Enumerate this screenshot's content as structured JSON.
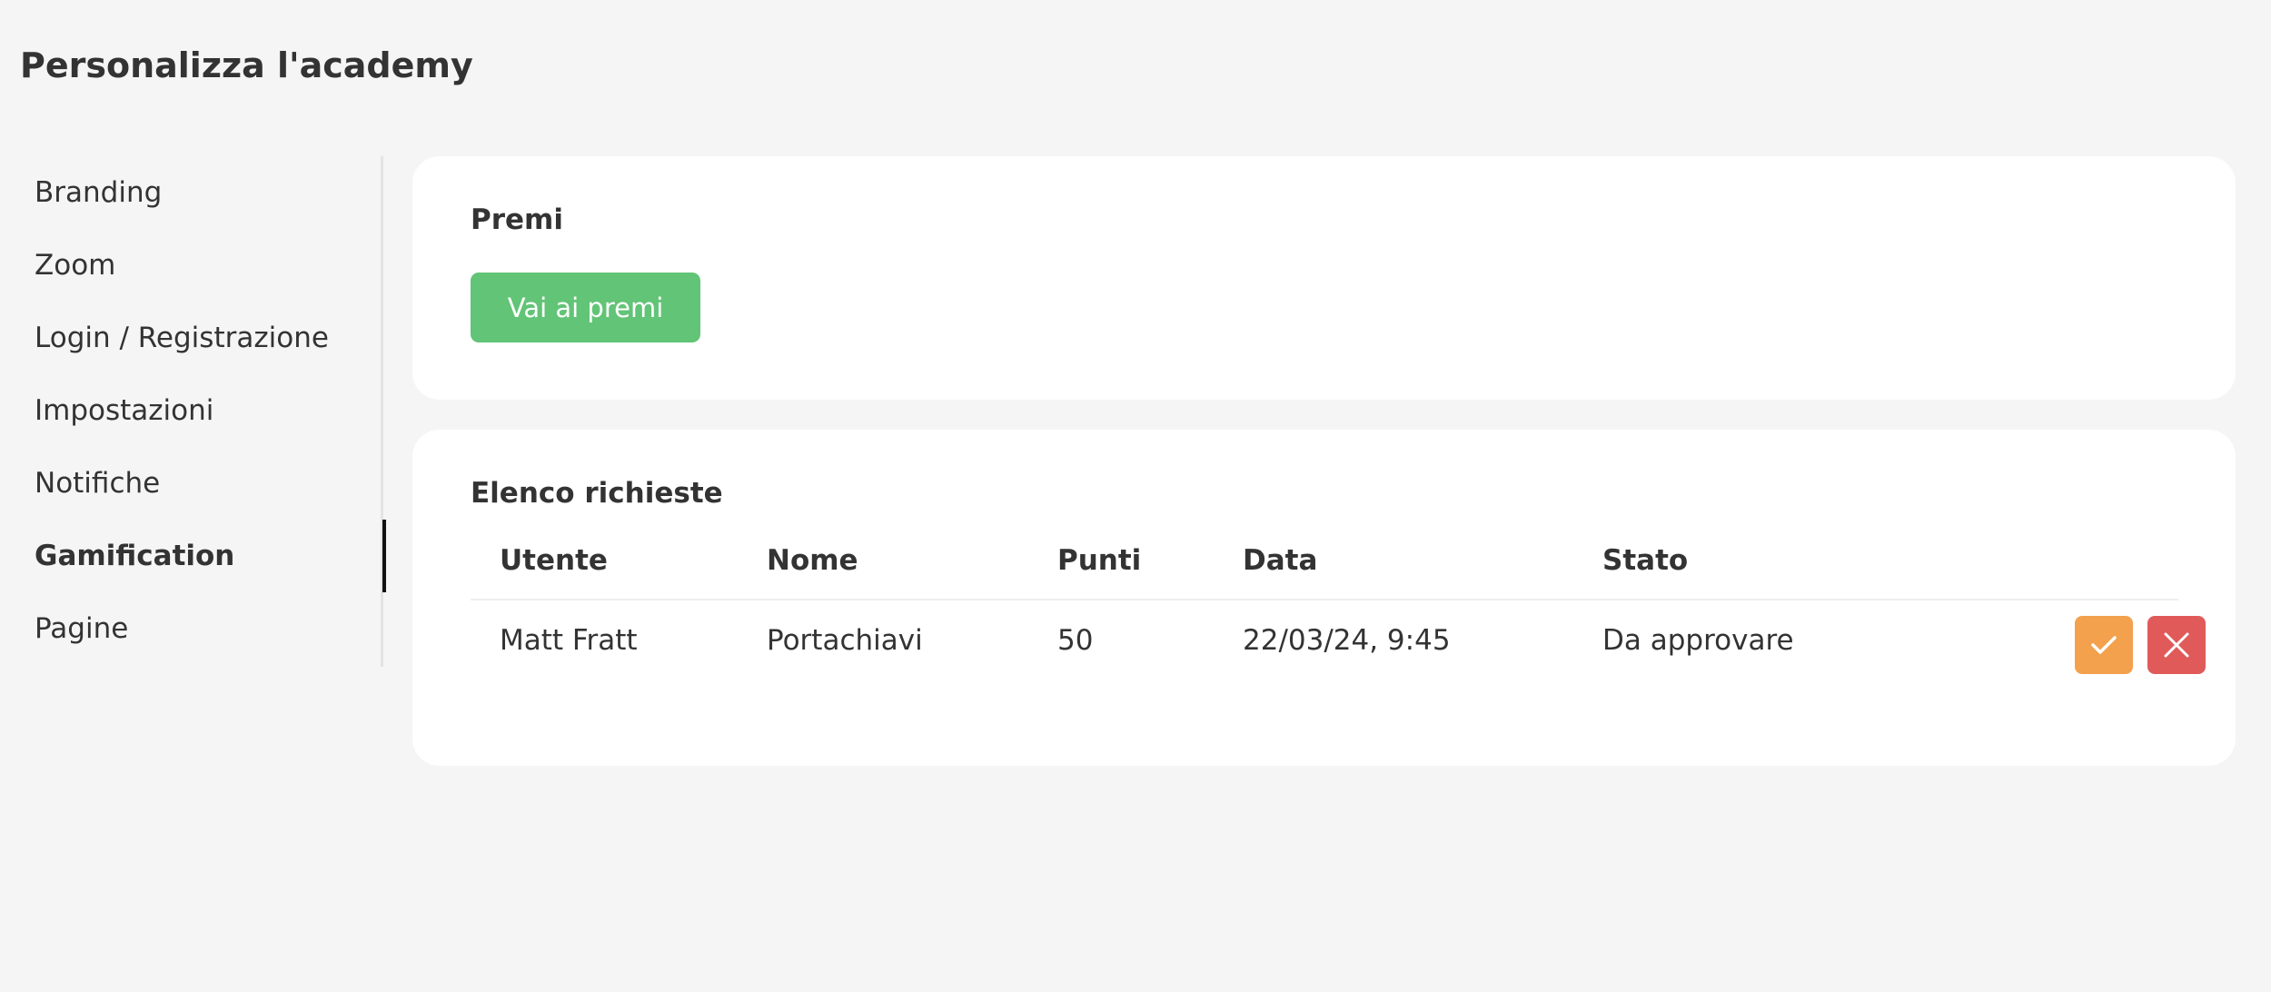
{
  "page": {
    "title": "Personalizza l'academy"
  },
  "sidebar": {
    "items": [
      {
        "label": "Branding"
      },
      {
        "label": "Zoom"
      },
      {
        "label": "Login / Registrazione"
      },
      {
        "label": "Impostazioni"
      },
      {
        "label": "Notifiche"
      },
      {
        "label": "Gamification",
        "active": true
      },
      {
        "label": "Pagine"
      }
    ]
  },
  "premi": {
    "title": "Premi",
    "button_label": "Vai ai premi"
  },
  "richieste": {
    "title": "Elenco richieste",
    "columns": [
      "Utente",
      "Nome",
      "Punti",
      "Data",
      "Stato"
    ],
    "rows": [
      {
        "utente": "Matt Fratt",
        "nome": "Portachiavi",
        "punti": "50",
        "data": "22/03/24, 9:45",
        "stato": "Da approvare"
      }
    ]
  },
  "colors": {
    "primary_green": "#62c476",
    "approve_orange": "#f3a14d",
    "reject_red": "#e05a5a",
    "background": "#f5f5f5"
  },
  "icons": {
    "approve": "check-icon",
    "reject": "close-icon"
  }
}
